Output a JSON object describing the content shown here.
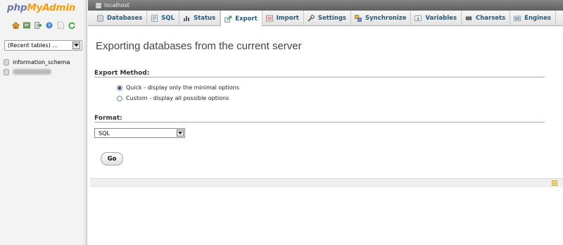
{
  "logo": {
    "php": "php",
    "myadmin": "MyAdmin"
  },
  "nav_icons": [
    "home-icon",
    "sql-window-icon",
    "logout-icon",
    "help-icon",
    "docs-icon",
    "reload-icon"
  ],
  "sidebar": {
    "recent_tables": "(Recent tables) ...",
    "databases": [
      {
        "name": "information_schema"
      },
      {
        "name": ""
      }
    ]
  },
  "server": {
    "name": "localhost"
  },
  "tabs": [
    {
      "label": "Databases",
      "icon": "database-icon"
    },
    {
      "label": "SQL",
      "icon": "sql-icon"
    },
    {
      "label": "Status",
      "icon": "status-icon"
    },
    {
      "label": "Export",
      "icon": "export-icon",
      "active": true
    },
    {
      "label": "Import",
      "icon": "import-icon"
    },
    {
      "label": "Settings",
      "icon": "settings-icon"
    },
    {
      "label": "Synchronize",
      "icon": "synchronize-icon"
    },
    {
      "label": "Variables",
      "icon": "variables-icon"
    },
    {
      "label": "Charsets",
      "icon": "charsets-icon"
    },
    {
      "label": "Engines",
      "icon": "engines-icon"
    }
  ],
  "main": {
    "title": "Exporting databases from the current server",
    "export_method": {
      "legend": "Export Method:",
      "options": [
        {
          "label": "Quick - display only the minimal options",
          "checked": true
        },
        {
          "label": "Custom - display all possible options",
          "checked": false
        }
      ]
    },
    "format": {
      "legend": "Format:",
      "selected": "SQL"
    },
    "go_label": "Go"
  },
  "colors": {
    "tab_text": "#235a81",
    "logo_php": "#6c78af",
    "logo_myadmin": "#f89c0e"
  }
}
